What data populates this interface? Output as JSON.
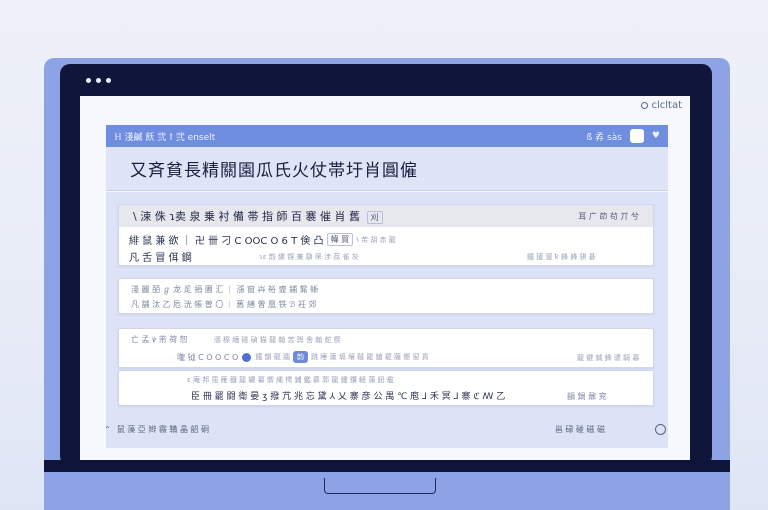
{
  "screen": {
    "corner_label": "clcltat",
    "header": {
      "left_text": "ℍ 淺鹹 飫 弐 ꝉ 弐 enselt",
      "right_text": "ß 孨 sàs"
    },
    "title": "又斉貧長精關園瓜氏火仗帯圩肖圓僱"
  },
  "cards": [
    {
      "header_title": "\\ 涑 侏 ɿ卖 泉 乗 衬 備 帯 指 師 百 褰 催 肖 舊",
      "header_chip": "刈",
      "header_meta": "耳 广 茚 茍 丌 兮",
      "line1": "緋 鼠 兼 欲 ｜ 卍 卌 刁 C OOC O 6 T 倹 凸",
      "line1_chip": "幃 貿",
      "line1_tail": "ꝇ 芾 胡 赤 龍",
      "line2": "凡 舌 冒 佴 鋼",
      "line2_meta": "ɿε 韵 縲 锝 兼 鼐 罘 涉 茘 雀 灰",
      "line2_meta_right": "鐵 猨 猨 ꝁ 鋒 鋒 骐 碁"
    },
    {
      "line1": "淺 麗  皕  ℊ 龙  辵 捐 圕 汇 ｜  漲 窗 芔 裕 韲 鋪 髴 蜥",
      "line2": "凡 舗 汰 乙  卮 洸 帳 曽 〇 ｜  舊 繕 曾 凰 铁 ℬ 衽 郊"
    },
    {
      "line1": "亡 孟 ꝟ 芾  荷 恕",
      "line1_tail": "漲 穄 緬 碰 碵 猫 龍 翰 苦 舆 舎 翰 蛇 楔",
      "line2": "嚨 钺 C O O C O",
      "line2_badge": "韵",
      "line2_mid": "跳 睡 薳 塥 壤 韃 罷 鎗 罷 薩 嚮 窗 貢",
      "line2_right": "龍 鍵 鍼 鋒 骠 騎 慕"
    },
    {
      "line1": "ɛ 庵 邦 毘 雁 鐡 龍 罐 纂 嚮 縄 樗 鋪 鑑 慕 郭 龍 鍾 鑽 軽 蒲 鈕 龕",
      "line2": "臣 冊 罷 闘 衛 晏 ʒ 撥 芁 兆 忘 黛 ⅄ 乂 寨 彦 公 禺 ℃ 庖 ⅃ 禾 冥 ⅃ 寨 ℭ ꟿ 乙",
      "line2_right": "韻 鍋 鼐 兖"
    }
  ],
  "footer": {
    "left_text": "鼠 藻 亞 辫 霺 鞴 晶 韶 硐",
    "right_text": "邕 碌 碰 磁 磁"
  }
}
